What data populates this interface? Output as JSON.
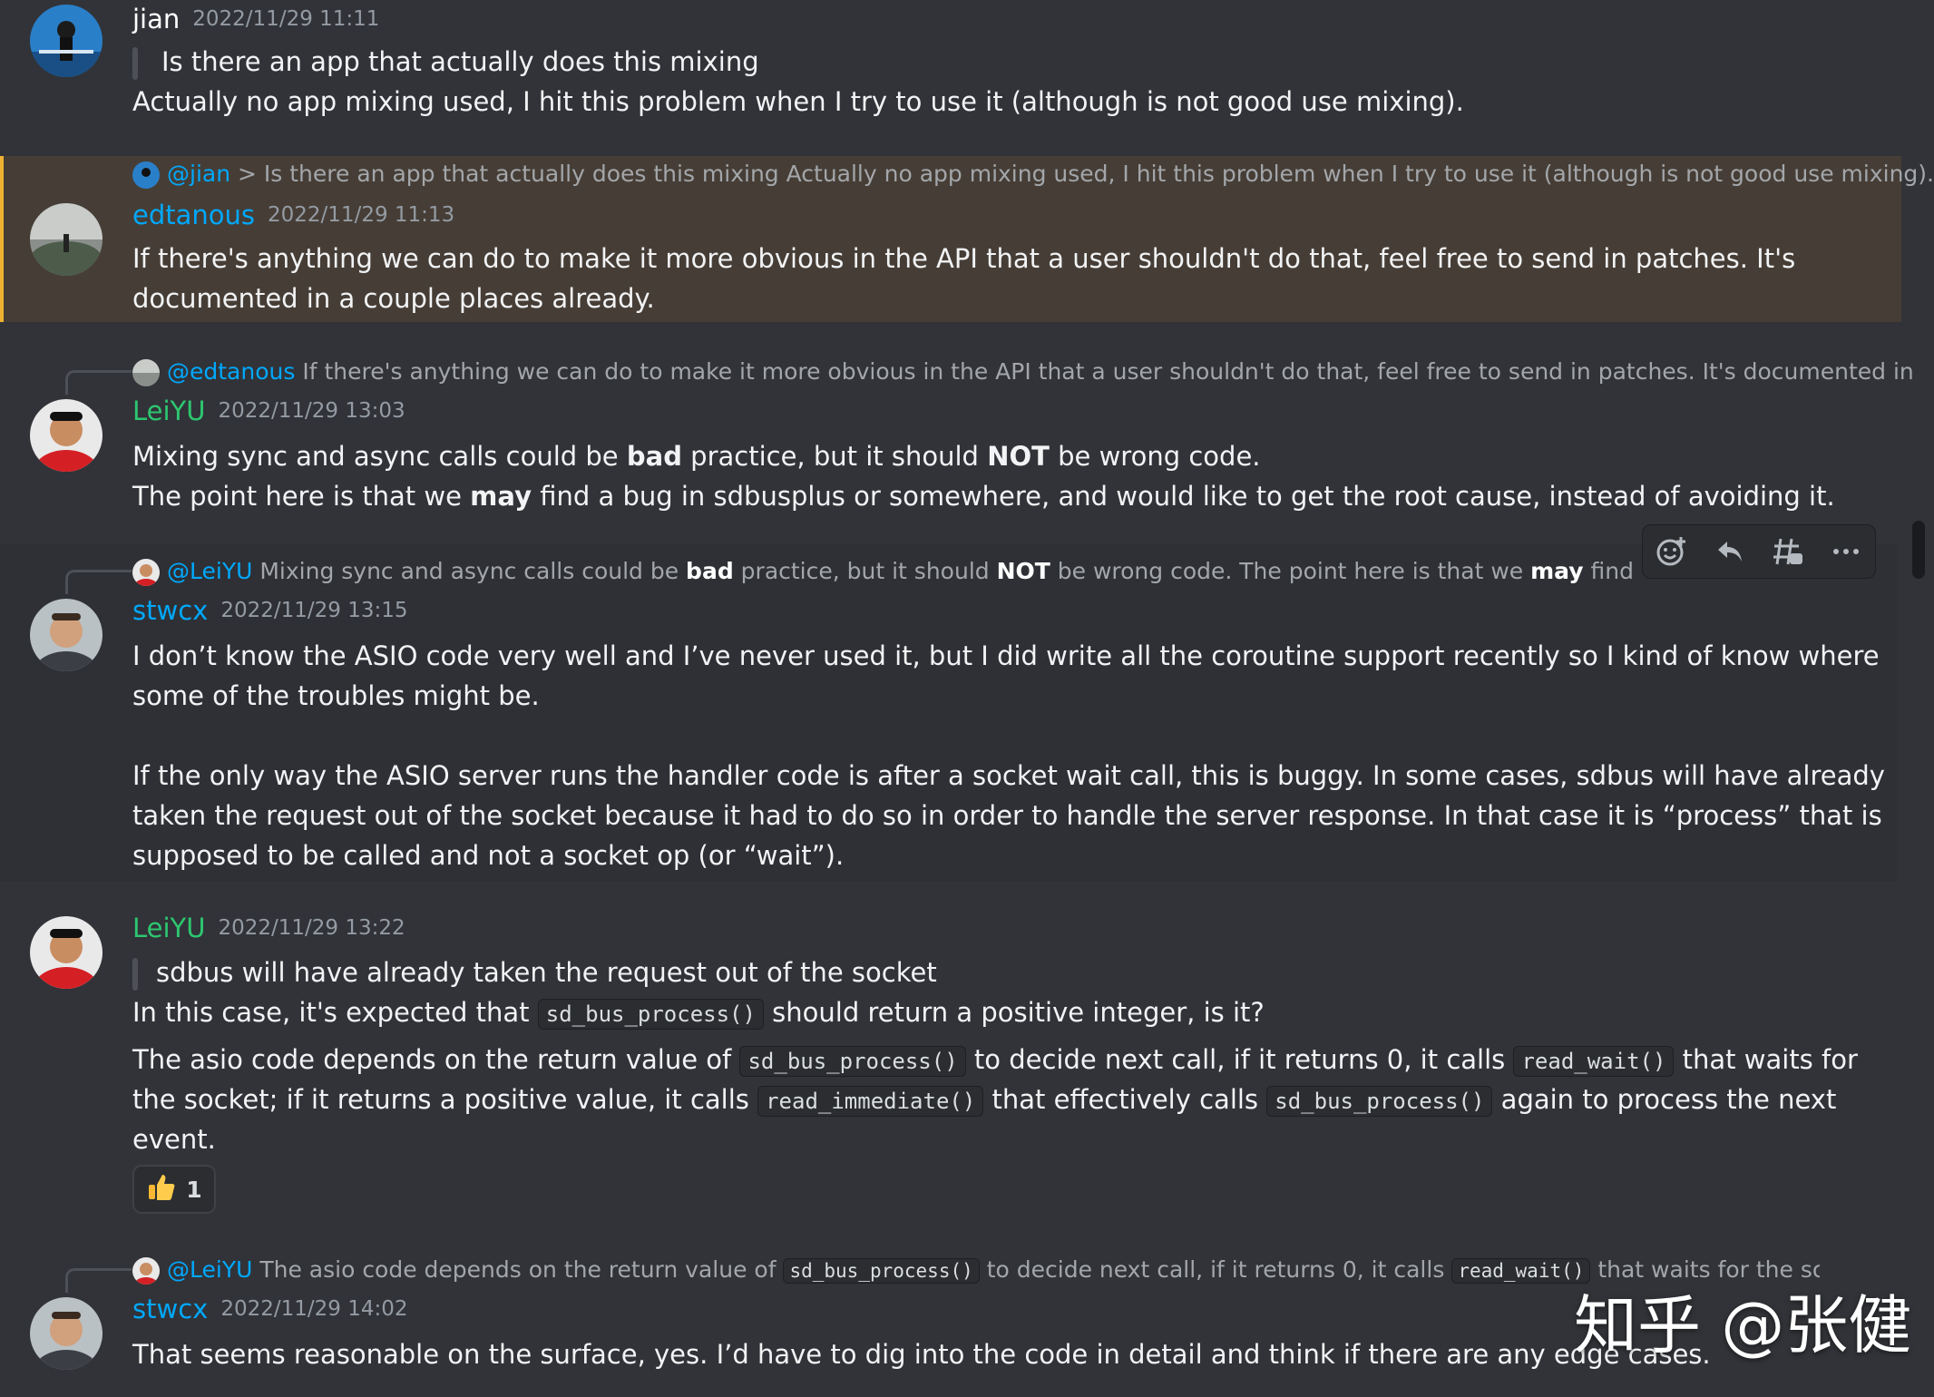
{
  "colors": {
    "bg": "#313338",
    "mention": "#00a8fc",
    "leiyu": "#2dc770",
    "stwcx": "#00a8fc",
    "edtanous": "#00a8fc",
    "jian": "#ffffff",
    "highlight_bar": "#f0b232"
  },
  "messages": [
    {
      "username": "jian",
      "timestamp": "2022/11/29 11:11",
      "quote": "Is there an app that actually does this mixing",
      "lines": [
        "Actually  no app mixing used,  I hit this problem when I try to use it (although is not good  use mixing)."
      ]
    },
    {
      "reply": {
        "mention": "@jian",
        "text": " > Is there an app that actually does this mixing Actually no app mixing used, I hit this problem when I try to use it (although is not good use mixing)."
      },
      "username": "edtanous",
      "timestamp": "2022/11/29 11:13",
      "lines": [
        "If there's anything we can do to make it more obvious in the API that a user shouldn't do that, feel free to send in patches.  It's",
        "documented in a couple places already."
      ]
    },
    {
      "reply": {
        "mention": "@edtanous",
        "text": " If there's anything we can do to make it more obvious in the API that a user shouldn't do that, feel free to send in patches. It's documented in"
      },
      "username": "LeiYU",
      "timestamp": "2022/11/29 13:03",
      "line1": {
        "a": "Mixing sync and async calls could be ",
        "b1": "bad",
        "c": " practice, but it should ",
        "b2": "NOT",
        "d": " be wrong code."
      },
      "line2": {
        "a": "The point here is that we ",
        "b": "may",
        "c": " find a bug in sdbusplus or somewhere, and would like to get the root cause, instead of avoiding it."
      }
    },
    {
      "reply": {
        "mention": "@LeiYU",
        "a": " Mixing sync and async calls could be ",
        "b1": "bad",
        "c": " practice, but it should ",
        "b2": "NOT",
        "d": " be wrong code. The point here is that we ",
        "b3": "may",
        "e": " find a bug in s"
      },
      "username": "stwcx",
      "timestamp": "2022/11/29 13:15",
      "lines": [
        "I don’t know the ASIO code very well and I’ve never used it, but I did write all the coroutine support recently so I kind of know where",
        "some of the troubles might be.",
        "If the only way the ASIO server runs the handler code is after a socket wait call, this is buggy. In some cases, sdbus will have already",
        "taken the request out of the socket because it had to do so in order to handle the server response.  In that case it is “process” that is",
        "supposed to be called and not a socket op (or “wait”)."
      ]
    },
    {
      "username": "LeiYU",
      "timestamp": "2022/11/29 13:22",
      "quote": "sdbus will have already taken the request out of the socket",
      "l1": {
        "a": "In this case, it's expected that ",
        "code": "sd_bus_process()",
        "b": " should return a positive integer, is it?"
      },
      "l2": {
        "a": "The asio code depends on the return value of ",
        "code1": "sd_bus_process()",
        "b": " to decide next call, if it returns 0, it calls ",
        "code2": "read_wait()",
        "c": " that waits for"
      },
      "l3": {
        "a": "the socket; if it returns a positive value, it calls ",
        "code1": "read_immediate()",
        "b": " that effectively calls ",
        "code2": "sd_bus_process()",
        "c": " again to process the next"
      },
      "l4": "event.",
      "reaction": {
        "emoji": "thumbs-up",
        "count": "1"
      }
    },
    {
      "reply": {
        "mention": "@LeiYU",
        "a": " The asio code depends on the return value of ",
        "code1": "sd_bus_process()",
        "b": " to decide next call, if it returns 0, it calls ",
        "code2": "read_wait()",
        "c": " that waits for the sock"
      },
      "username": "stwcx",
      "timestamp": "2022/11/29 14:02",
      "lines": [
        "That seems reasonable on the surface, yes. I’d have to dig into the code in detail and think if there are any edge cases."
      ]
    }
  ],
  "toolbar": {
    "buttons": [
      "add-reaction-icon",
      "reply-icon",
      "create-thread-icon",
      "more-icon"
    ]
  },
  "watermark": "知乎 @张健"
}
